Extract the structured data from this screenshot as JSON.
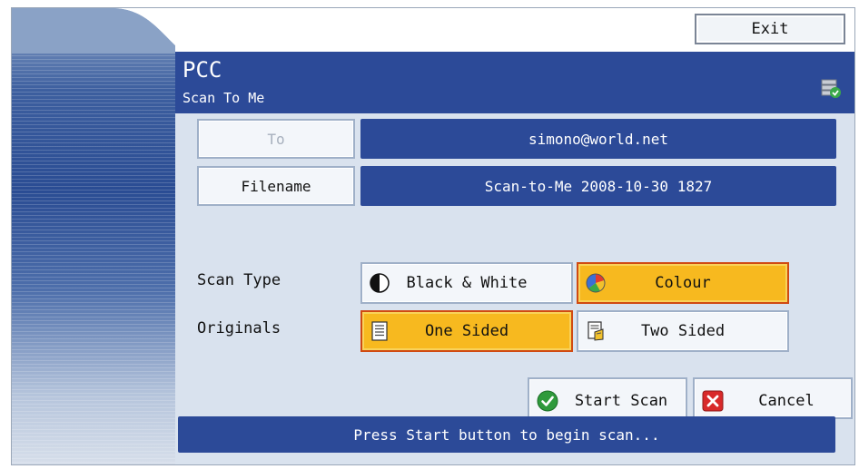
{
  "header": {
    "title": "PCC",
    "subtitle": "Scan To Me",
    "status_icon": "server-check-icon"
  },
  "toolbar": {
    "exit_label": "Exit"
  },
  "fields": {
    "to": {
      "label": "To",
      "value": "simono@world.net"
    },
    "filename": {
      "label": "Filename",
      "value": "Scan-to-Me 2008-10-30 1827"
    }
  },
  "scan_type": {
    "label": "Scan Type",
    "options": [
      {
        "label": "Black & White",
        "icon": "half-circle-icon",
        "selected": false
      },
      {
        "label": "Colour",
        "icon": "color-wheel-icon",
        "selected": true
      }
    ]
  },
  "originals": {
    "label": "Originals",
    "options": [
      {
        "label": "One Sided",
        "icon": "single-page-icon",
        "selected": true
      },
      {
        "label": "Two Sided",
        "icon": "double-page-icon",
        "selected": false
      }
    ]
  },
  "actions": {
    "start_label": "Start Scan",
    "cancel_label": "Cancel"
  },
  "message": "Press Start button to begin scan...",
  "colors": {
    "header_blue": "#2c4a98",
    "selected_orange": "#f7b91f",
    "selected_border": "#d04a12"
  }
}
